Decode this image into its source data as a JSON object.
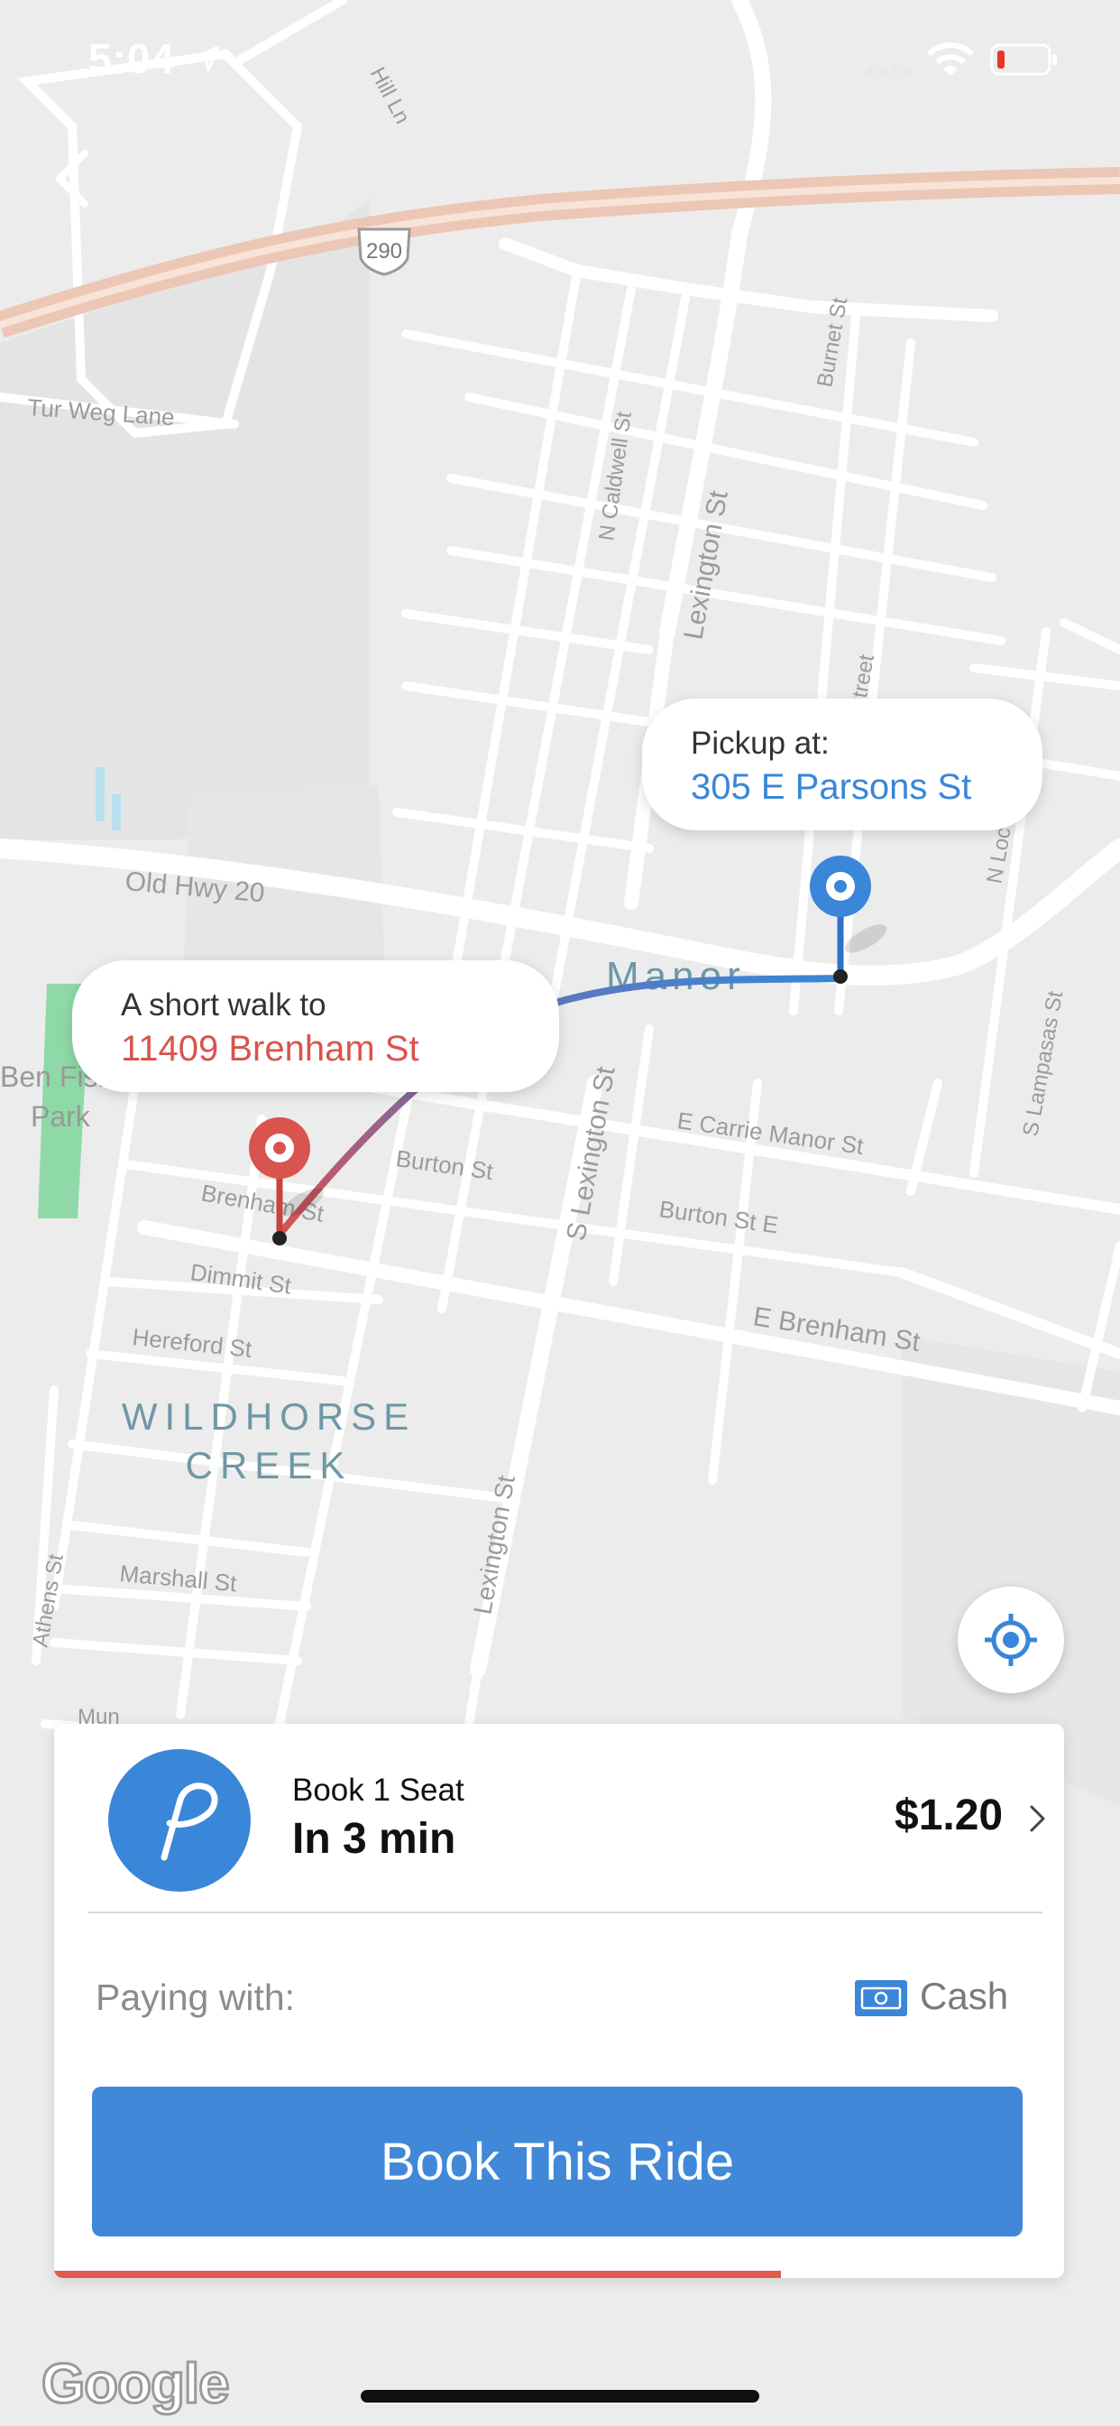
{
  "status_bar": {
    "time": "5:04"
  },
  "map": {
    "labels": {
      "highway_shield": "290",
      "tur_weg_lane": "Tur Weg Lane",
      "hill_ln": "Hill Ln",
      "n_caldwell_st": "N Caldwell St",
      "lexington_st_north": "Lexington St",
      "burnet_st": "Burnet St",
      "street_top": "Street",
      "n_loc": "N Loc",
      "old_hwy_20": "Old Hwy 20",
      "manor": "Manor",
      "ben_fish_park_1": "Ben Fish",
      "ben_fish_park_2": "Park",
      "burton_st": "Burton St",
      "brenham_st": "Brenham St",
      "dimmit_st": "Dimmit St",
      "hereford_st": "Hereford St",
      "wildhorse": "WILDHORSE",
      "creek": "CREEK",
      "s_lexington_st": "S Lexington St",
      "e_carrie_manor_st": "E Carrie Manor St",
      "burton_st_e": "Burton St E",
      "e_brenham_st": "E Brenham St",
      "s_lampasas_st": "S Lampasas St",
      "lexington_st_south": "Lexington St",
      "athens_st": "Athens St",
      "marshall_st": "Marshall St",
      "mun": "Mun"
    }
  },
  "pickup": {
    "label": "Pickup at:",
    "address": "305 E Parsons St"
  },
  "dropoff": {
    "label": "A short walk to",
    "address": "11409 Brenham St"
  },
  "ride_card": {
    "seats_label": "Book 1 Seat",
    "eta": "In 3 min",
    "price": "$1.20",
    "paying_label": "Paying with:",
    "payment_method": "Cash",
    "book_button": "Book This Ride",
    "progress_fraction": 0.72
  },
  "footer": {
    "google": "Google"
  },
  "colors": {
    "accent_blue": "#4188d8",
    "pickup_blue": "#3a86d8",
    "dropoff_red": "#d9534f",
    "progress_red": "#e05b4d"
  },
  "icons": [
    "back-icon",
    "location-arrow-icon",
    "wifi-icon",
    "battery-icon",
    "locate-me-icon",
    "pickup-pin-icon",
    "dropoff-pin-icon",
    "via-logo-icon",
    "chevron-right-icon",
    "cash-icon"
  ]
}
